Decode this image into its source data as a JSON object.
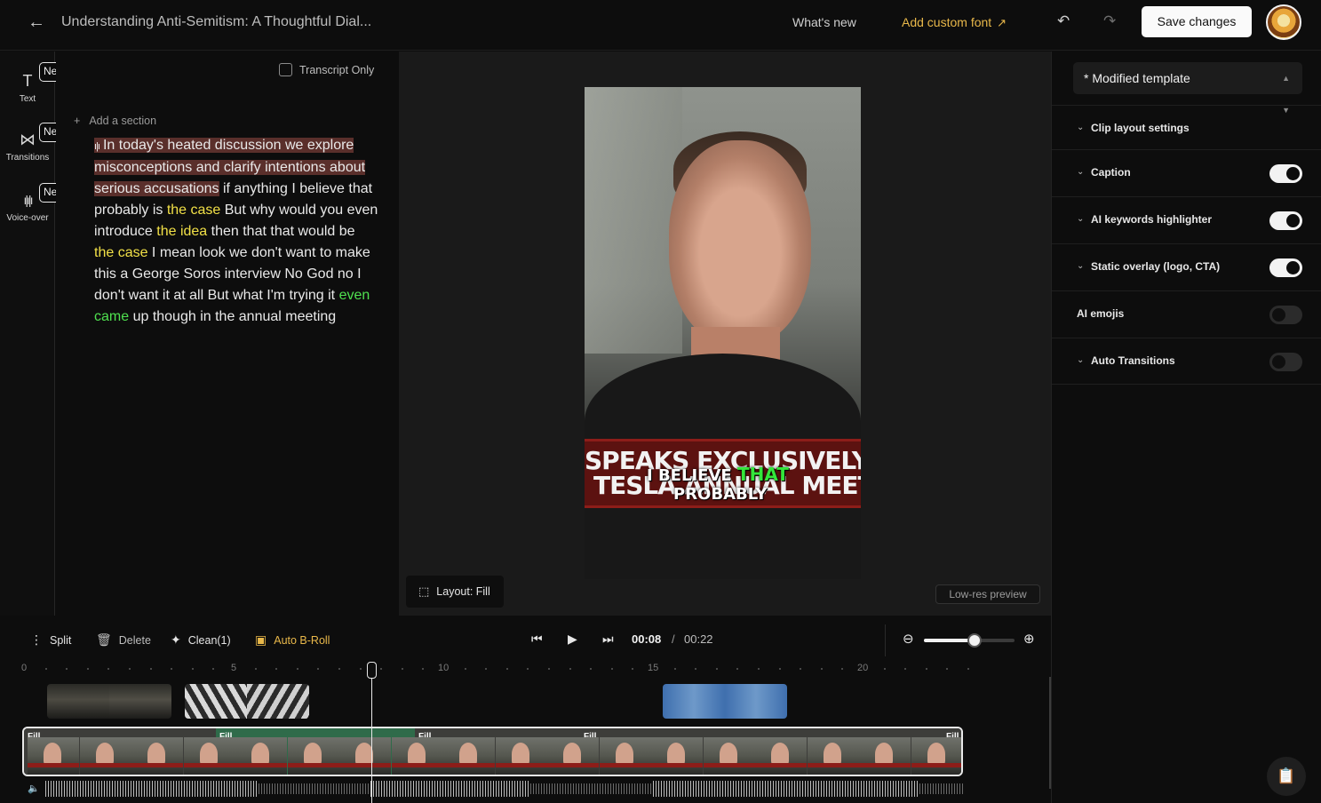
{
  "header": {
    "back_icon": "arrow-left-icon",
    "title": "Understanding Anti-Semitism: A Thoughtful Dial...",
    "whats_new": "What's new",
    "custom_font": "Add custom font",
    "external_icon": "external-link-icon",
    "undo_icon": "undo-icon",
    "redo_icon": "redo-icon",
    "save_label": "Save changes"
  },
  "rail": {
    "tools": [
      {
        "label": "Text",
        "icon": "text-icon",
        "badge": "New"
      },
      {
        "label": "Transitions",
        "icon": "transitions-icon",
        "badge": "New"
      },
      {
        "label": "Voice-over",
        "icon": "voice-over-icon",
        "badge": "New"
      }
    ]
  },
  "transcript": {
    "transcript_only": "Transcript Only",
    "add_section": "Add a section",
    "highlighted": "In today's heated discussion we explore misconceptions and clarify intentions about serious accusations",
    "seg1": " if anything I believe that probably is ",
    "kw1": "the case",
    "seg2": " But why would you even introduce ",
    "kw2": "the idea",
    "seg3": " then that that would be ",
    "kw3": "the case",
    "seg4": " I mean look we don't want to make this a George Soros interview No God no I don't want it at all But what I'm trying it ",
    "kw4": "even came",
    "seg5": " up though in the annual meeting"
  },
  "preview": {
    "banner_line1": "SPEAKS EXCLUSIVELY T",
    "banner_line2": "TESLA ANNUAL MEETIN",
    "caption_word1": "I BELIEVE",
    "caption_word2": "THAT",
    "caption_word3": "PROBABLY",
    "layout_label": "Layout: Fill",
    "lowres_label": "Low-res preview"
  },
  "settings": {
    "template": "* Modified template",
    "items": [
      {
        "label": "Clip layout settings",
        "expandable": true,
        "toggle": null
      },
      {
        "label": "Caption",
        "expandable": true,
        "toggle": "on"
      },
      {
        "label": "AI keywords highlighter",
        "expandable": true,
        "toggle": "on"
      },
      {
        "label": "Static overlay (logo, CTA)",
        "expandable": true,
        "toggle": "on"
      },
      {
        "label": "AI emojis",
        "expandable": false,
        "toggle": "off"
      },
      {
        "label": "Auto Transitions",
        "expandable": true,
        "toggle": "off"
      }
    ]
  },
  "toolbar": {
    "split": "Split",
    "delete": "Delete",
    "clean": "Clean(1)",
    "auto_broll": "Auto B-Roll",
    "current_time": "00:08",
    "separator": "/",
    "total_time": "00:22",
    "zoom_level": 0.56
  },
  "timeline": {
    "ruler": [
      "0",
      "5",
      "10",
      "15",
      "20"
    ],
    "segment_label": "Fill",
    "playhead_seconds": 8
  },
  "colors": {
    "accent_orange": "#e9b84a",
    "keyword_yellow": "#f1e047",
    "keyword_green": "#4fe04f",
    "highlight_bg": "#5a2f2b",
    "banner_red": "#8d1d19"
  }
}
